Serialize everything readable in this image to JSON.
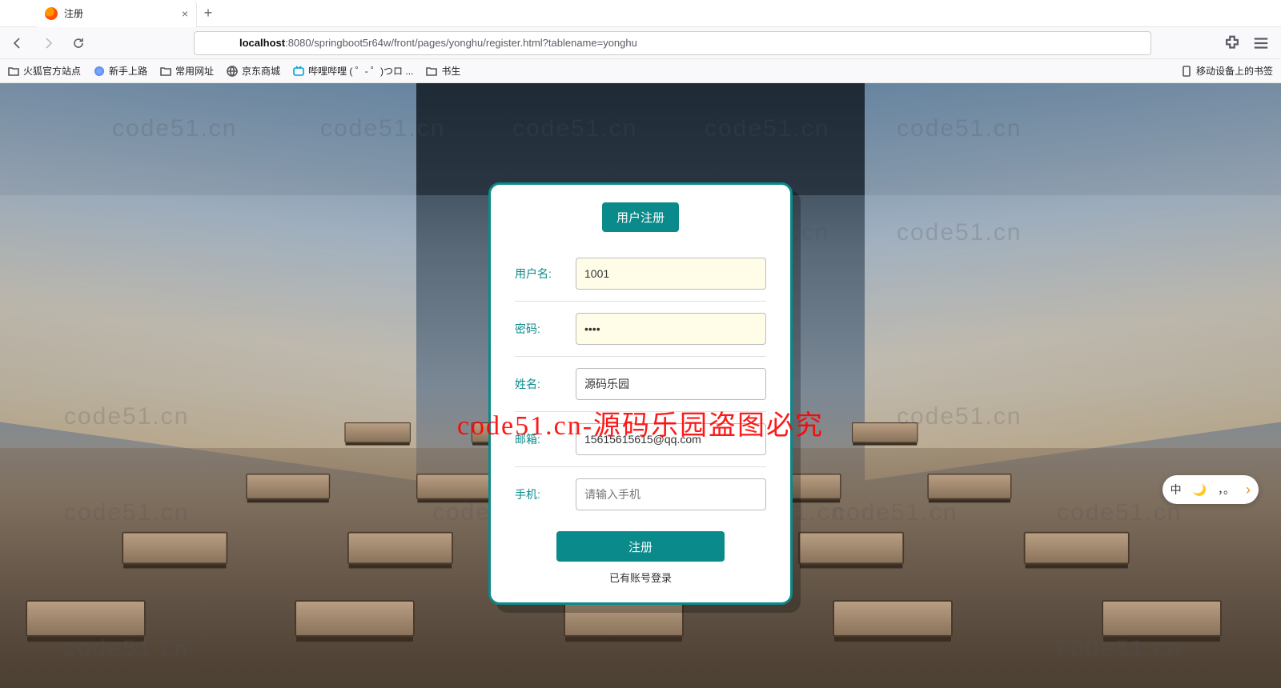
{
  "window": {
    "tab_title": "注册",
    "url_prefix": "localhost",
    "url_rest": ":8080/springboot5r64w/front/pages/yonghu/register.html?tablename=yonghu"
  },
  "bookmarks": {
    "items": [
      {
        "label": "火狐官方站点"
      },
      {
        "label": "新手上路"
      },
      {
        "label": "常用网址"
      },
      {
        "label": "京东商城"
      },
      {
        "label": "哔哩哔哩 ( ゜- ゜)つロ ..."
      },
      {
        "label": "书生"
      }
    ],
    "mobile": "移动设备上的书签"
  },
  "form": {
    "title": "用户注册",
    "username": {
      "label": "用户名:",
      "value": "1001"
    },
    "password": {
      "label": "密码:",
      "value": "••••"
    },
    "name": {
      "label": "姓名:",
      "value": "源码乐园"
    },
    "email": {
      "label": "邮箱:",
      "value": "15615615615@qq.com"
    },
    "phone": {
      "label": "手机:",
      "placeholder": "请输入手机"
    },
    "submit": "注册",
    "login_link": "已有账号登录"
  },
  "watermark": {
    "small": "code51.cn",
    "big": "code51.cn-源码乐园盗图必究"
  },
  "ime": {
    "lang": "中",
    "mode": "，。"
  }
}
